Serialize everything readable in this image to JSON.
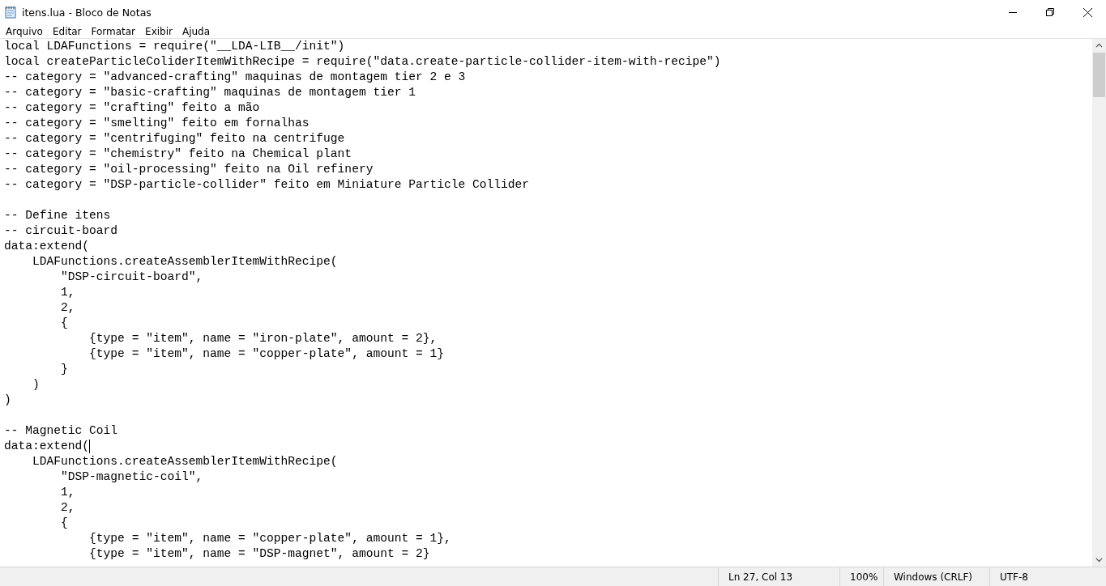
{
  "window": {
    "title": "itens.lua - Bloco de Notas"
  },
  "menu": [
    "Arquivo",
    "Editar",
    "Formatar",
    "Exibir",
    "Ajuda"
  ],
  "editor": {
    "lines": [
      {
        "text": "local LDAFunctions = require(\"__LDA-LIB__/init\")",
        "caret": false
      },
      {
        "text": "local createParticleColiderItemWithRecipe = require(\"data.create-particle-collider-item-with-recipe\")",
        "caret": false
      },
      {
        "text": "-- category = \"advanced-crafting\" maquinas de montagem tier 2 e 3",
        "caret": false
      },
      {
        "text": "-- category = \"basic-crafting\" maquinas de montagem tier 1",
        "caret": false
      },
      {
        "text": "-- category = \"crafting\" feito a mão",
        "caret": false
      },
      {
        "text": "-- category = \"smelting\" feito em fornalhas",
        "caret": false
      },
      {
        "text": "-- category = \"centrifuging\" feito na centrifuge",
        "caret": false
      },
      {
        "text": "-- category = \"chemistry\" feito na Chemical plant",
        "caret": false
      },
      {
        "text": "-- category = \"oil-processing\" feito na Oil refinery",
        "caret": false
      },
      {
        "text": "-- category = \"DSP-particle-collider\" feito em Miniature Particle Collider",
        "caret": false
      },
      {
        "caret": false
      },
      {
        "text": "-- Define itens",
        "caret": false
      },
      {
        "text": "-- circuit-board",
        "caret": false
      },
      {
        "text": "data:extend(",
        "caret": false
      },
      {
        "text": "    LDAFunctions.createAssemblerItemWithRecipe(",
        "caret": false
      },
      {
        "text": "        \"DSP-circuit-board\",",
        "caret": false
      },
      {
        "text": "        1,",
        "caret": false
      },
      {
        "text": "        2,",
        "caret": false
      },
      {
        "text": "        {",
        "caret": false
      },
      {
        "text": "            {type = \"item\", name = \"iron-plate\", amount = 2},",
        "caret": false
      },
      {
        "text": "            {type = \"item\", name = \"copper-plate\", amount = 1}",
        "caret": false
      },
      {
        "text": "        }",
        "caret": false
      },
      {
        "text": "    )",
        "caret": false
      },
      {
        "text": ")",
        "caret": false
      },
      {
        "caret": false
      },
      {
        "text": "-- Magnetic Coil",
        "caret": false
      },
      {
        "text": "data:extend(",
        "caret": true
      },
      {
        "text": "    LDAFunctions.createAssemblerItemWithRecipe(",
        "caret": false
      },
      {
        "text": "        \"DSP-magnetic-coil\",",
        "caret": false
      },
      {
        "text": "        1,",
        "caret": false
      },
      {
        "text": "        2,",
        "caret": false
      },
      {
        "text": "        {",
        "caret": false
      },
      {
        "text": "            {type = \"item\", name = \"copper-plate\", amount = 1},",
        "caret": false
      },
      {
        "text": "            {type = \"item\", name = \"DSP-magnet\", amount = 2}",
        "caret": false
      }
    ]
  },
  "status_bar": {
    "position": "Ln 27, Col 13",
    "zoom": "100%",
    "line_ending": "Windows (CRLF)",
    "encoding": "UTF-8"
  }
}
